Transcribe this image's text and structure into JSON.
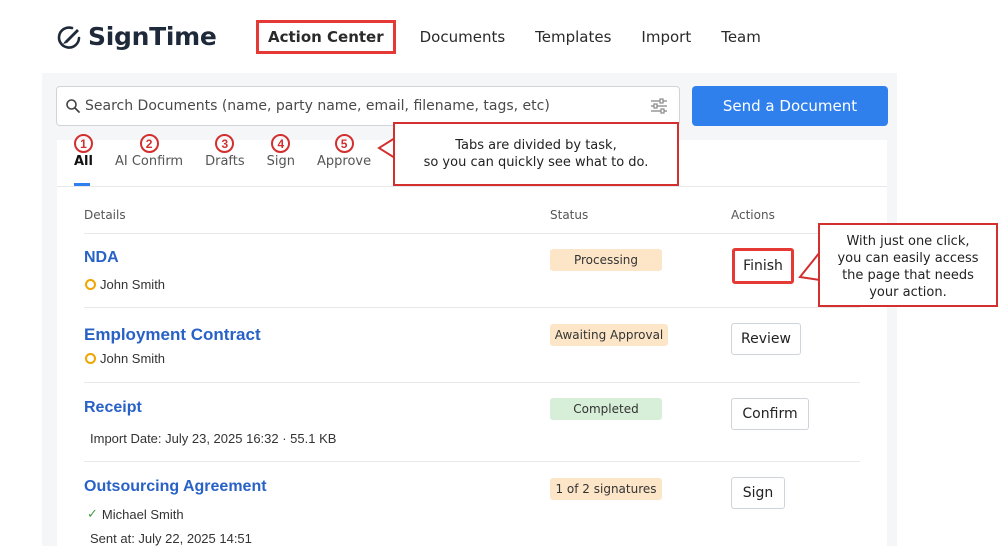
{
  "brand": {
    "name": "SignTime"
  },
  "nav": {
    "items": [
      {
        "label": "Action Center"
      },
      {
        "label": "Documents"
      },
      {
        "label": "Templates"
      },
      {
        "label": "Import"
      },
      {
        "label": "Team"
      }
    ]
  },
  "search": {
    "placeholder": "Search Documents (name, party name, email, filename, tags, etc)"
  },
  "send_button": "Send a Document",
  "tabs": [
    {
      "num": "1",
      "label": "All"
    },
    {
      "num": "2",
      "label": "AI Confirm"
    },
    {
      "num": "3",
      "label": "Drafts"
    },
    {
      "num": "4",
      "label": "Sign"
    },
    {
      "num": "5",
      "label": "Approve"
    }
  ],
  "callouts": {
    "tabs": {
      "line1": "Tabs are divided by task,",
      "line2": "so you can quickly see what to do."
    },
    "actions": {
      "line1": "With just one click,",
      "line2": "you can easily access",
      "line3": "the page that needs",
      "line4": "your action."
    }
  },
  "table": {
    "headers": {
      "details": "Details",
      "status": "Status",
      "actions": "Actions"
    },
    "rows": [
      {
        "title": "NDA",
        "party": "John Smith",
        "status": "Processing",
        "action": "Finish"
      },
      {
        "title": "Employment Contract",
        "party": "John Smith",
        "status": "Awaiting Approval",
        "action": "Review"
      },
      {
        "title": "Receipt",
        "meta": "Import Date: July 23, 2025 16:32 · 55.1 KB",
        "status": "Completed",
        "action": "Confirm"
      },
      {
        "title": "Outsourcing Agreement",
        "party": "Michael Smith",
        "meta": "Sent at: July 22, 2025 14:51",
        "status": "1 of 2 signatures",
        "action": "Sign"
      }
    ]
  },
  "colors": {
    "accent": "#2f80ed",
    "highlight": "#e53935",
    "link": "#2962c7"
  }
}
